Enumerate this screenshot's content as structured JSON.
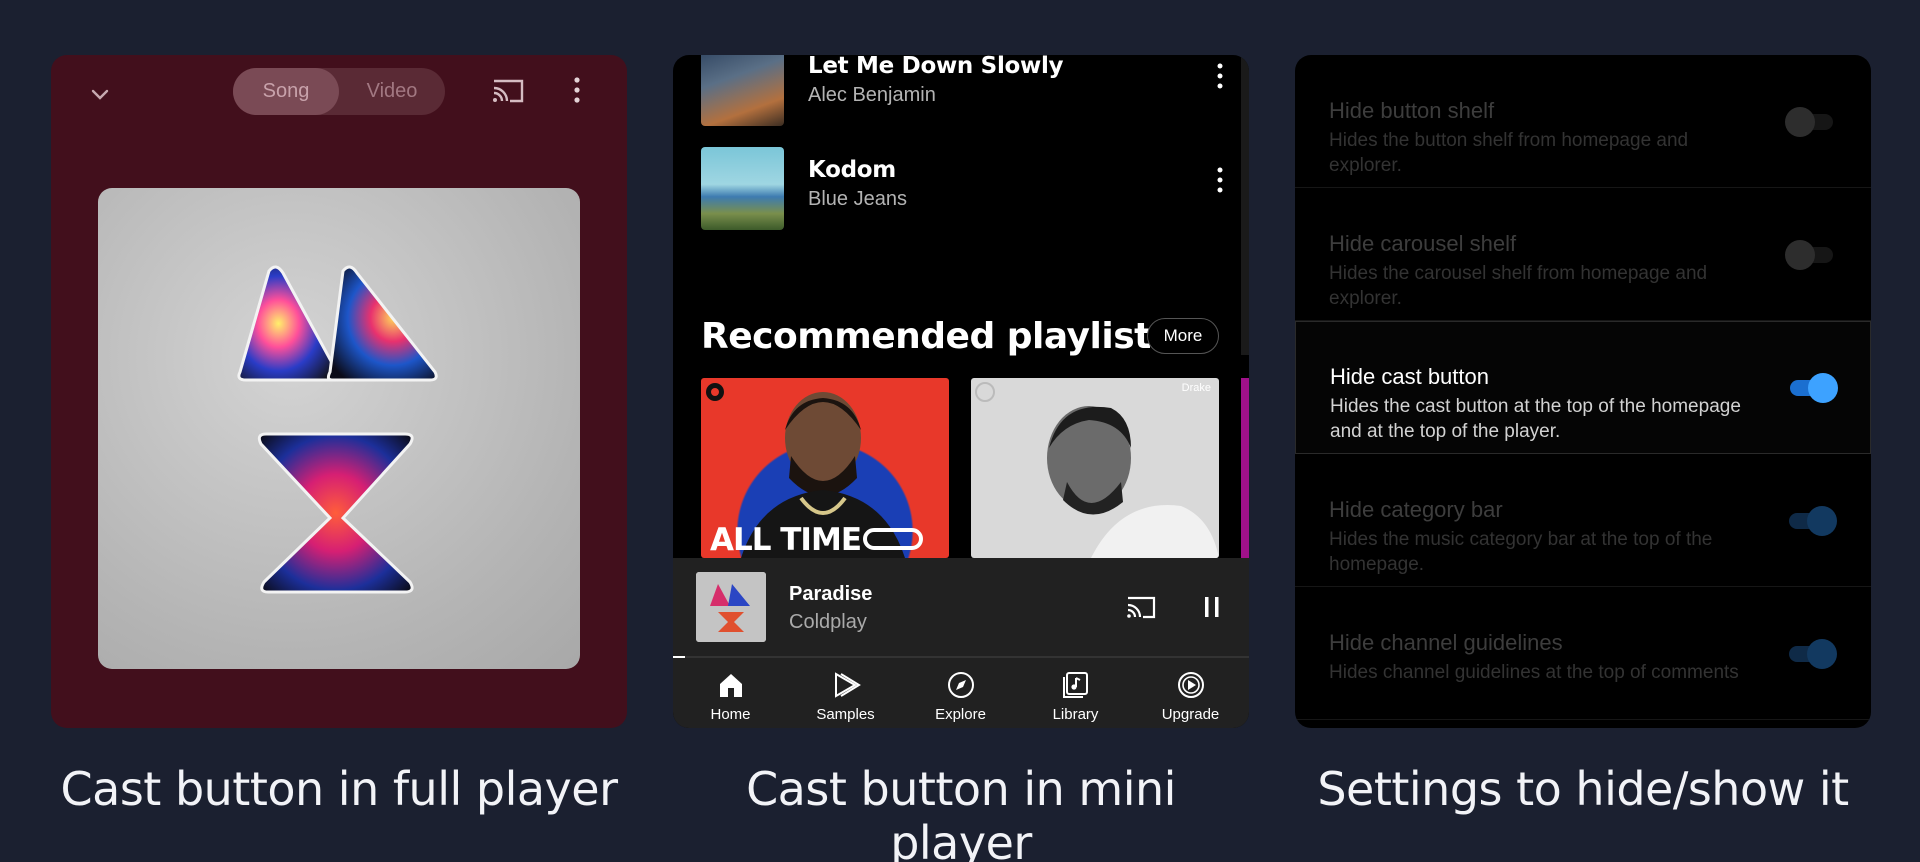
{
  "captions": {
    "full_player": "Cast button in full player",
    "mini_player": "Cast button in mini player",
    "settings": "Settings to hide/show it"
  },
  "full_player": {
    "segment": {
      "song": "Song",
      "video": "Video",
      "selected": "Song"
    },
    "icons": [
      "chevron-down-icon",
      "cast-icon",
      "more-vert-icon"
    ],
    "colors": {
      "background": "#420f1c"
    }
  },
  "mini_player_screen": {
    "songs": [
      {
        "title": "Let Me Down Slowly",
        "artist": "Alec Benjamin"
      },
      {
        "title": "Kodom",
        "artist": "Blue Jeans"
      }
    ],
    "recommended": {
      "title": "Recommended playlists",
      "more": "More"
    },
    "playlists": [
      {
        "overlay": "ALL TIME"
      },
      {
        "overlay": "Drake"
      }
    ],
    "now_playing": {
      "title": "Paradise",
      "artist": "Coldplay",
      "progress": 0.02
    },
    "nav": [
      {
        "label": "Home",
        "icon": "home-icon"
      },
      {
        "label": "Samples",
        "icon": "samples-icon"
      },
      {
        "label": "Explore",
        "icon": "explore-icon"
      },
      {
        "label": "Library",
        "icon": "library-icon"
      },
      {
        "label": "Upgrade",
        "icon": "upgrade-icon"
      }
    ]
  },
  "settings": [
    {
      "title": "Hide button shelf",
      "desc": "Hides the button shelf from homepage and explorer.",
      "state": "off",
      "enabled": false
    },
    {
      "title": "Hide carousel shelf",
      "desc": "Hides the carousel shelf from homepage and explorer.",
      "state": "off",
      "enabled": false
    },
    {
      "title": "Hide cast button",
      "desc": "Hides the cast button at the top of the homepage and at the top of the player.",
      "state": "on",
      "enabled": true
    },
    {
      "title": "Hide category bar",
      "desc": "Hides the music category bar at the top of the homepage.",
      "state": "on",
      "enabled": false
    },
    {
      "title": "Hide channel guidelines",
      "desc": "Hides channel guidelines at the top of comments",
      "state": "on",
      "enabled": false
    }
  ]
}
